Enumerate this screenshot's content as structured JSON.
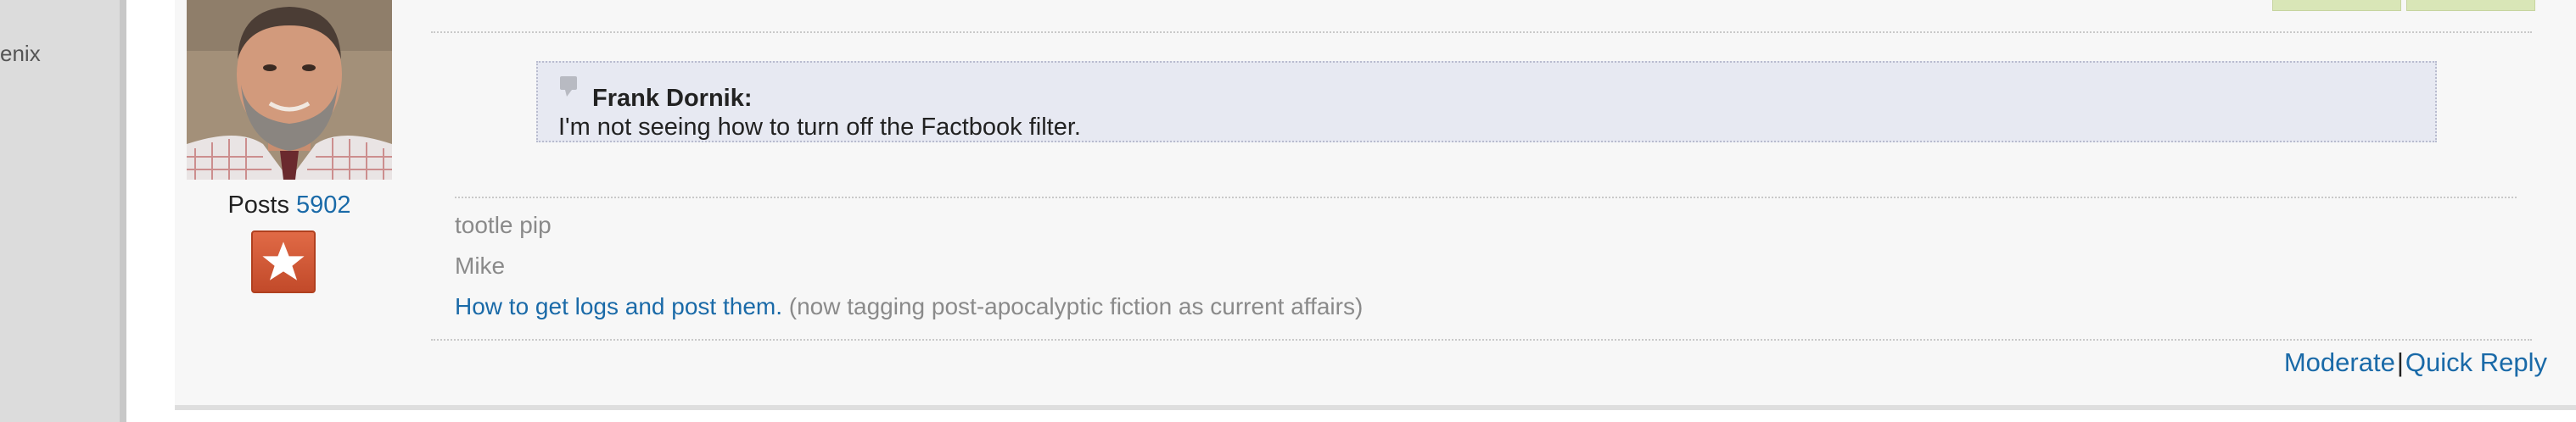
{
  "sidebar": {
    "partial_text": "enix"
  },
  "user": {
    "posts_label": "Posts",
    "posts_count": "5902",
    "avatar_icon": "user-avatar-photo",
    "rank_icon": "star-badge-icon"
  },
  "quote": {
    "author": "Frank Dornik:",
    "text": "I'm not seeing how to turn off the Factbook filter."
  },
  "signature": {
    "line1": "tootle pip",
    "line2": "Mike",
    "link_text": "How to get logs and post them.",
    "suffix": "(now tagging post-apocalyptic fiction as current affairs)"
  },
  "footer": {
    "moderate_label": "Moderate",
    "separator": "|",
    "quick_reply_label": "Quick Reply"
  },
  "colors": {
    "link": "#1a6aa8",
    "quote_bg": "#e7e9f2",
    "badge": "#d0532f",
    "post_bg": "#f7f7f7"
  }
}
